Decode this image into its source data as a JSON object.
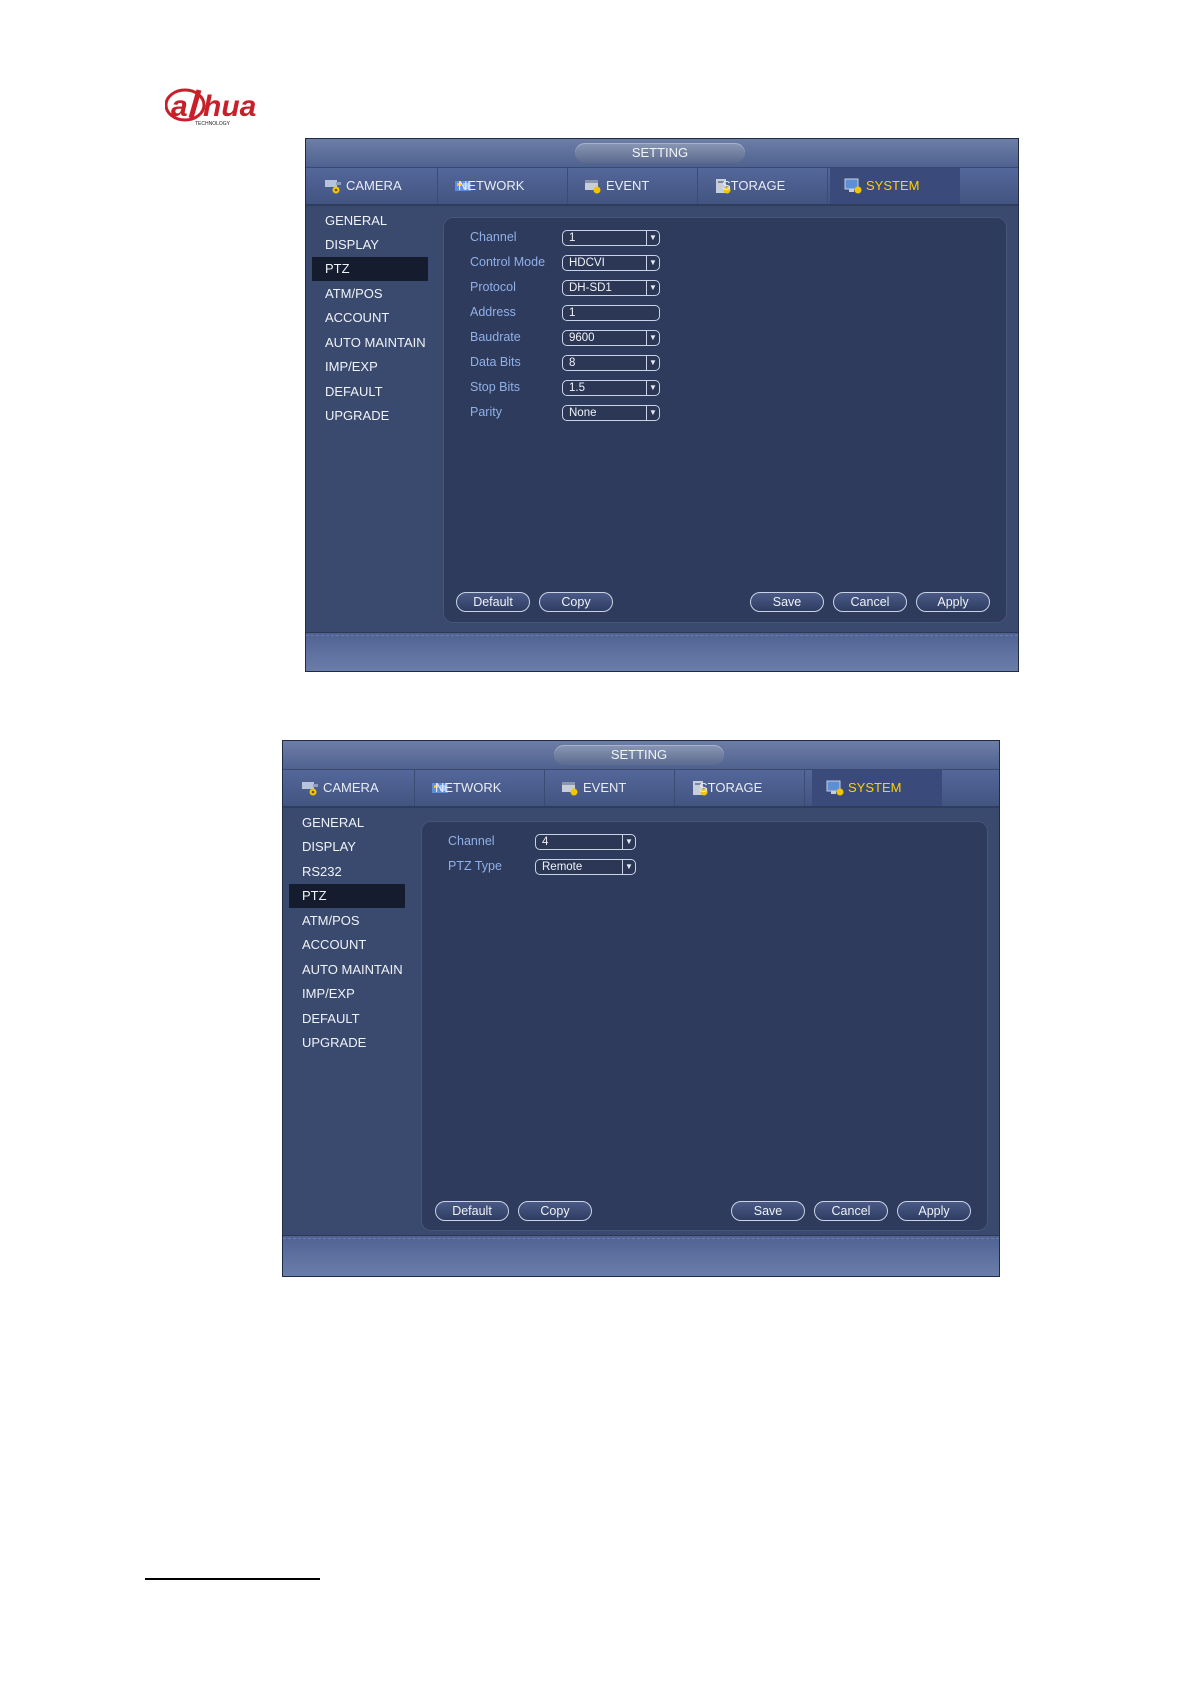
{
  "logo": {
    "word": "alhua",
    "sub": "TECHNOLOGY"
  },
  "colors": {
    "window_bg": "#3a4a6e",
    "panel_bg": "#2f3b5c",
    "active_tab_text": "#ffd200",
    "field_label": "#8fb0e8",
    "sidebar_selected": "#141c2e"
  },
  "tabs": [
    {
      "label": "CAMERA",
      "icon": "camera-gear-icon"
    },
    {
      "label": "NETWORK",
      "icon": "network-icon"
    },
    {
      "label": "EVENT",
      "icon": "event-icon"
    },
    {
      "label": "STORAGE",
      "icon": "storage-icon"
    },
    {
      "label": "SYSTEM",
      "icon": "system-monitor-icon",
      "active": true
    }
  ],
  "window1": {
    "title": "SETTING",
    "sidebar": [
      "GENERAL",
      "DISPLAY",
      "PTZ",
      "ATM/POS",
      "ACCOUNT",
      "AUTO MAINTAIN",
      "IMP/EXP",
      "DEFAULT",
      "UPGRADE"
    ],
    "selected_sidebar": "PTZ",
    "fields": [
      {
        "label": "Channel",
        "value": "1"
      },
      {
        "label": "Control Mode",
        "value": "HDCVI"
      },
      {
        "label": "Protocol",
        "value": "DH-SD1"
      },
      {
        "label": "Address",
        "value": "1"
      },
      {
        "label": "Baudrate",
        "value": "9600"
      },
      {
        "label": "Data Bits",
        "value": "8"
      },
      {
        "label": "Stop Bits",
        "value": "1.5"
      },
      {
        "label": "Parity",
        "value": "None"
      }
    ],
    "buttons": {
      "default": "Default",
      "copy": "Copy",
      "save": "Save",
      "cancel": "Cancel",
      "apply": "Apply"
    }
  },
  "window2": {
    "title": "SETTING",
    "sidebar": [
      "GENERAL",
      "DISPLAY",
      "RS232",
      "PTZ",
      "ATM/POS",
      "ACCOUNT",
      "AUTO MAINTAIN",
      "IMP/EXP",
      "DEFAULT",
      "UPGRADE"
    ],
    "selected_sidebar": "PTZ",
    "fields": [
      {
        "label": "Channel",
        "value": "4"
      },
      {
        "label": "PTZ Type",
        "value": "Remote"
      }
    ],
    "buttons": {
      "default": "Default",
      "copy": "Copy",
      "save": "Save",
      "cancel": "Cancel",
      "apply": "Apply"
    }
  }
}
